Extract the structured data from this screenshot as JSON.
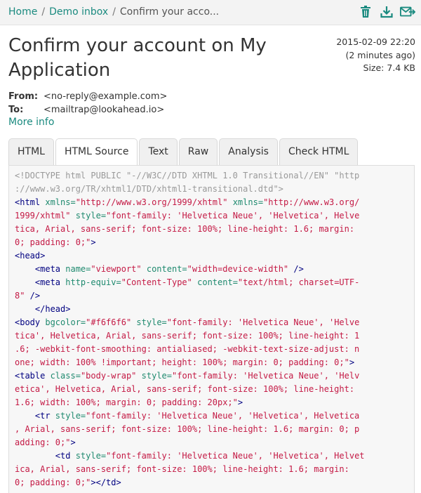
{
  "breadcrumb": {
    "home": "Home",
    "sep1": "/",
    "inbox": "Demo inbox",
    "sep2": "/",
    "current": "Confirm your acco..."
  },
  "toolbar": {
    "icons": [
      "trash-icon",
      "download-icon",
      "forward-mail-icon"
    ],
    "accent": "#1a8a7f"
  },
  "message": {
    "subject": "Confirm your account on My Application",
    "date": "2015-02-09 22:20",
    "relative": "(2 minutes ago)",
    "size": "Size: 7.4 KB",
    "from_label": "From:",
    "from": "<no-reply@example.com>",
    "to_label": "To:",
    "to": "<mailtrap@lookahead.io>",
    "more_info": "More info"
  },
  "tabs": [
    {
      "label": "HTML",
      "active": false
    },
    {
      "label": "HTML Source",
      "active": true
    },
    {
      "label": "Text",
      "active": false
    },
    {
      "label": "Raw",
      "active": false
    },
    {
      "label": "Analysis",
      "active": false
    },
    {
      "label": "Check HTML",
      "active": false
    }
  ],
  "source": {
    "lines": [
      [
        [
          "dt",
          "<!DOCTYPE html PUBLIC \"-//W3C//DTD XHTML 1.0 Transitional//EN\" \"http"
        ]
      ],
      [
        [
          "dt",
          "://www.w3.org/TR/xhtml1/DTD/xhtml1-transitional.dtd\">"
        ]
      ],
      [
        [
          "tg",
          "<html "
        ],
        [
          "at",
          "xmlns="
        ],
        [
          "vl",
          "\"http://www.w3.org/1999/xhtml\""
        ],
        [
          "tg",
          " "
        ],
        [
          "at",
          "xmlns="
        ],
        [
          "vl",
          "\"http://www.w3.org/"
        ]
      ],
      [
        [
          "vl",
          "1999/xhtml\""
        ],
        [
          "tg",
          " "
        ],
        [
          "at",
          "style="
        ],
        [
          "vl",
          "\"font-family: 'Helvetica Neue', 'Helvetica', Helve"
        ]
      ],
      [
        [
          "vl",
          "tica, Arial, sans-serif; font-size: 100%; line-height: 1.6; margin:"
        ]
      ],
      [
        [
          "vl",
          "0; padding: 0;\""
        ],
        [
          "tg",
          ">"
        ]
      ],
      [
        [
          "tg",
          "<head>"
        ]
      ],
      [
        [
          "tg",
          "    <meta "
        ],
        [
          "at",
          "name="
        ],
        [
          "vl",
          "\"viewport\""
        ],
        [
          "tg",
          " "
        ],
        [
          "at",
          "content="
        ],
        [
          "vl",
          "\"width=device-width\""
        ],
        [
          "tg",
          " />"
        ]
      ],
      [
        [
          "tg",
          "    <meta "
        ],
        [
          "at",
          "http-equiv="
        ],
        [
          "vl",
          "\"Content-Type\""
        ],
        [
          "tg",
          " "
        ],
        [
          "at",
          "content="
        ],
        [
          "vl",
          "\"text/html; charset=UTF-"
        ]
      ],
      [
        [
          "vl",
          "8\""
        ],
        [
          "tg",
          " />"
        ]
      ],
      [
        [
          "tg",
          "    </head>"
        ]
      ],
      [
        [
          "tg",
          "<body "
        ],
        [
          "at",
          "bgcolor="
        ],
        [
          "vl",
          "\"#f6f6f6\""
        ],
        [
          "tg",
          " "
        ],
        [
          "at",
          "style="
        ],
        [
          "vl",
          "\"font-family: 'Helvetica Neue', 'Helve"
        ]
      ],
      [
        [
          "vl",
          "tica', Helvetica, Arial, sans-serif; font-size: 100%; line-height: 1"
        ]
      ],
      [
        [
          "vl",
          ".6; -webkit-font-smoothing: antialiased; -webkit-text-size-adjust: n"
        ]
      ],
      [
        [
          "vl",
          "one; width: 100% !important; height: 100%; margin: 0; padding: 0;\""
        ],
        [
          "tg",
          ">"
        ]
      ],
      [
        [
          "tg",
          "<table "
        ],
        [
          "at",
          "class="
        ],
        [
          "vl",
          "\"body-wrap\""
        ],
        [
          "tg",
          " "
        ],
        [
          "at",
          "style="
        ],
        [
          "vl",
          "\"font-family: 'Helvetica Neue', 'Helv"
        ]
      ],
      [
        [
          "vl",
          "etica', Helvetica, Arial, sans-serif; font-size: 100%; line-height:"
        ]
      ],
      [
        [
          "vl",
          "1.6; width: 100%; margin: 0; padding: 20px;\""
        ],
        [
          "tg",
          ">"
        ]
      ],
      [
        [
          "tg",
          "    <tr "
        ],
        [
          "at",
          "style="
        ],
        [
          "vl",
          "\"font-family: 'Helvetica Neue', 'Helvetica', Helvetica"
        ]
      ],
      [
        [
          "vl",
          ", Arial, sans-serif; font-size: 100%; line-height: 1.6; margin: 0; p"
        ]
      ],
      [
        [
          "vl",
          "adding: 0;\""
        ],
        [
          "tg",
          ">"
        ]
      ],
      [
        [
          "tg",
          "        <td "
        ],
        [
          "at",
          "style="
        ],
        [
          "vl",
          "\"font-family: 'Helvetica Neue', 'Helvetica', Helvet"
        ]
      ],
      [
        [
          "vl",
          "ica, Arial, sans-serif; font-size: 100%; line-height: 1.6; margin:"
        ]
      ],
      [
        [
          "vl",
          "0; padding: 0;\""
        ],
        [
          "tg",
          "></td>"
        ]
      ]
    ]
  }
}
